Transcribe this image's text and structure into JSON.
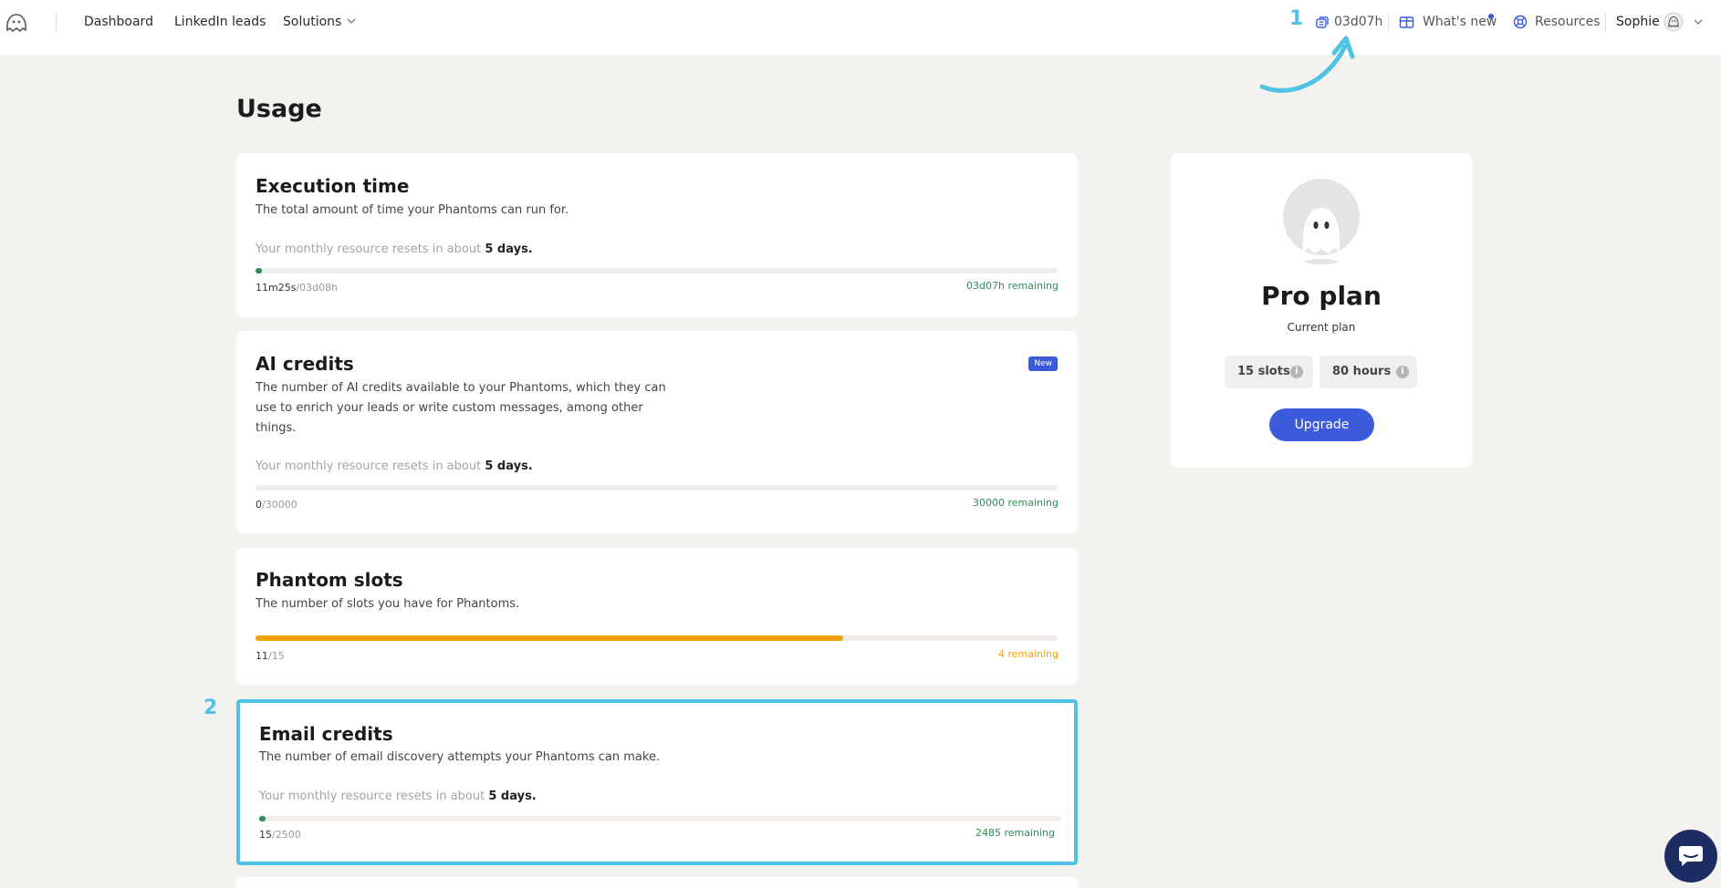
{
  "header": {
    "nav": {
      "dashboard": "Dashboard",
      "linkedin": "LinkedIn leads",
      "solutions": "Solutions"
    },
    "annotation_1": "1",
    "time_remaining": "03d07h",
    "whats_new": "What's new",
    "resources": "Resources",
    "user_name": "Sophie"
  },
  "page": {
    "title": "Usage"
  },
  "cards": {
    "execution": {
      "title": "Execution time",
      "description": "The total amount of time your Phantoms can run for.",
      "reset_prefix": "Your monthly resource resets in about ",
      "reset_value": "5 days.",
      "used": "11m25s",
      "total": "/03d08h",
      "remaining": "03d07h remaining",
      "progress_fraction": 0.002,
      "color": "#2f8a5a"
    },
    "ai": {
      "title": "AI credits",
      "badge": "New",
      "description": "The number of AI credits available to your Phantoms, which they can use to enrich your leads or write custom messages, among other things.",
      "reset_prefix": "Your monthly resource resets in about ",
      "reset_value": "5 days.",
      "used": "0",
      "total": "/30000",
      "remaining": "30000 remaining",
      "progress_fraction": 0,
      "color": "#2f8a5a"
    },
    "slots": {
      "title": "Phantom slots",
      "description": "The number of slots you have for Phantoms.",
      "used": "11",
      "total": "/15",
      "remaining": "4 remaining",
      "progress_fraction": 0.733,
      "color": "#f0a30a"
    },
    "email": {
      "annotation_2": "2",
      "title": "Email credits",
      "description": "The number of email discovery attempts your Phantoms can make.",
      "reset_prefix": "Your monthly resource resets in about ",
      "reset_value": "5 days.",
      "used": "15",
      "total": "/2500",
      "remaining": "2485 remaining",
      "progress_fraction": 0.006,
      "color": "#2f8a5a"
    }
  },
  "plan": {
    "name": "Pro plan",
    "subtitle": "Current plan",
    "slots": "15 slots",
    "hours": "80 hours",
    "upgrade": "Upgrade",
    "accent": "#3b5bdb"
  }
}
